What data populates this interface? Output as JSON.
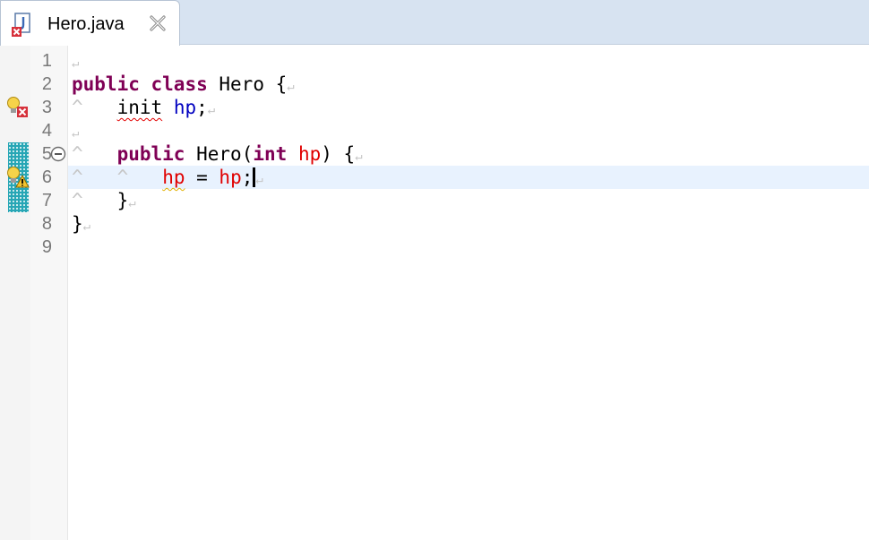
{
  "tab": {
    "title": "Hero.java",
    "icon": "java-file-with-error-icon",
    "close_icon": "close-icon"
  },
  "editor": {
    "line_numbers": [
      "1",
      "2",
      "3",
      "4",
      "5",
      "6",
      "7",
      "8",
      "9"
    ],
    "whitespace_glyph": "↵",
    "indent_glyph": "^",
    "code": {
      "l2": {
        "kw1": "public",
        "kw2": "class",
        "name": "Hero",
        "brace": "{"
      },
      "l3": {
        "type": "init",
        "field": "hp",
        "semi": ";"
      },
      "l5": {
        "kw1": "public",
        "name": "Hero",
        "open": "(",
        "kw2": "int",
        "param": "hp",
        "close": ")",
        "brace": "{"
      },
      "l6": {
        "field": "hp",
        "op": " = ",
        "param": "hp",
        "semi": ";"
      },
      "l7": {
        "brace": "}"
      },
      "l8": {
        "brace": "}"
      }
    },
    "markers": {
      "line3": "quickfix-error-icon",
      "line5": "fold-collapse-icon",
      "line6": "quickfix-warning-icon"
    },
    "colors": {
      "keyword": "#7f0055",
      "field": "#0000c0",
      "parameter": "#e00000",
      "current_line": "#e8f2fe",
      "overview_marker": "#27a6b5"
    }
  }
}
